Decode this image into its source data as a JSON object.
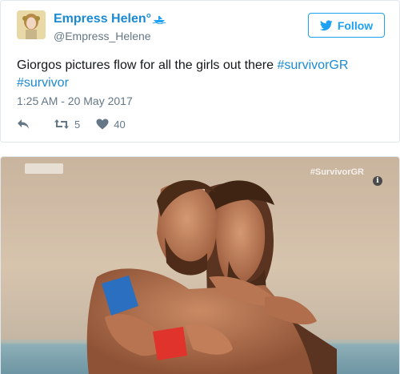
{
  "tweet": {
    "author": {
      "display_name": "Empress Helen°",
      "handle": "@Empress_Helene"
    },
    "follow_label": "Follow",
    "text_plain": "Giorgos pictures flow for all the girls out there ",
    "hashtags": [
      "#survivorGR",
      "#survivor"
    ],
    "timestamp": "1:25 AM - 20 May 2017",
    "retweet_count": "5",
    "like_count": "40",
    "icons": [
      "reply-icon",
      "retweet-icon",
      "like-icon",
      "twitter-bird-icon",
      "verified-boat-icon"
    ]
  },
  "media": {
    "watermark": "#SurvivorGR",
    "info_glyph": "i"
  },
  "colors": {
    "link": "#1b8ad3",
    "twitter_blue": "#1da1f2",
    "muted": "#657786",
    "border": "#e1e8ed"
  }
}
